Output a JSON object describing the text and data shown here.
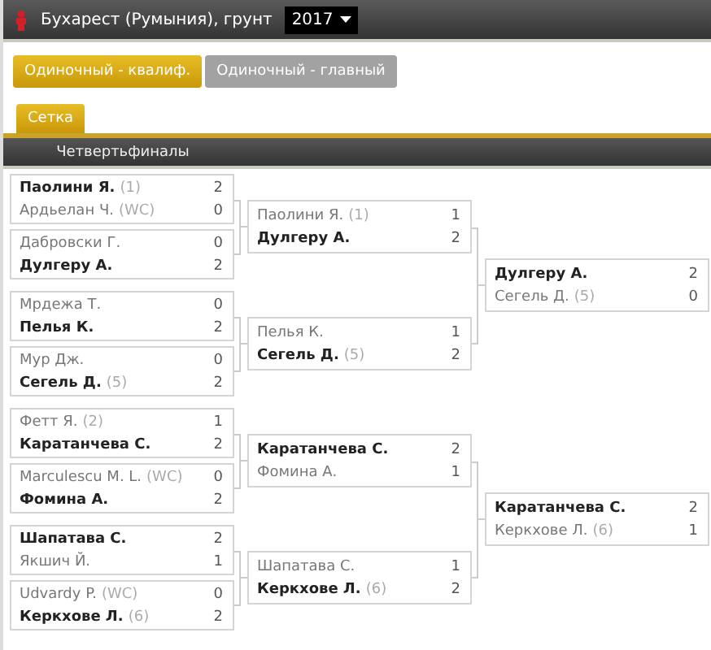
{
  "header": {
    "tournament": "Бухарест (Румыния), грунт",
    "year": "2017"
  },
  "draw_tabs": [
    {
      "label": "Одиночный - квалиф.",
      "selected": true
    },
    {
      "label": "Одиночный - главный",
      "selected": false
    }
  ],
  "view_tabs": [
    {
      "label": "Сетка",
      "selected": true
    }
  ],
  "rounds": [
    {
      "title": "Четвертьфиналы",
      "matches": [
        {
          "players": [
            {
              "name": "Паолини Я.",
              "seed": "(1)",
              "score": "2",
              "winner": true
            },
            {
              "name": "Ардьелан Ч.",
              "seed": "(WC)",
              "score": "0",
              "winner": false
            }
          ]
        },
        {
          "players": [
            {
              "name": "Дабровски Г.",
              "score": "0",
              "winner": false
            },
            {
              "name": "Дулгеру А.",
              "score": "2",
              "winner": true
            }
          ]
        },
        {
          "players": [
            {
              "name": "Мрдежа Т.",
              "score": "0",
              "winner": false
            },
            {
              "name": "Пелья К.",
              "score": "2",
              "winner": true
            }
          ]
        },
        {
          "players": [
            {
              "name": "Мур Дж.",
              "score": "0",
              "winner": false
            },
            {
              "name": "Сегель Д.",
              "seed": "(5)",
              "score": "2",
              "winner": true
            }
          ]
        },
        {
          "players": [
            {
              "name": "Фетт Я.",
              "seed": "(2)",
              "score": "1",
              "winner": false
            },
            {
              "name": "Каратанчева С.",
              "score": "2",
              "winner": true
            }
          ]
        },
        {
          "players": [
            {
              "name": "Marculescu M. L.",
              "seed": "(WC)",
              "score": "0",
              "winner": false
            },
            {
              "name": "Фомина А.",
              "score": "2",
              "winner": true
            }
          ]
        },
        {
          "players": [
            {
              "name": "Шапатава С.",
              "score": "2",
              "winner": true
            },
            {
              "name": "Якшич Й.",
              "score": "1",
              "winner": false
            }
          ]
        },
        {
          "players": [
            {
              "name": "Udvardy P.",
              "seed": "(WC)",
              "score": "0",
              "winner": false
            },
            {
              "name": "Керкхове Л.",
              "seed": "(6)",
              "score": "2",
              "winner": true
            }
          ]
        }
      ]
    },
    {
      "matches": [
        {
          "players": [
            {
              "name": "Паолини Я.",
              "seed": "(1)",
              "score": "1",
              "winner": false
            },
            {
              "name": "Дулгеру А.",
              "score": "2",
              "winner": true
            }
          ]
        },
        {
          "players": [
            {
              "name": "Пелья К.",
              "score": "1",
              "winner": false
            },
            {
              "name": "Сегель Д.",
              "seed": "(5)",
              "score": "2",
              "winner": true
            }
          ]
        },
        {
          "players": [
            {
              "name": "Каратанчева С.",
              "score": "2",
              "winner": true
            },
            {
              "name": "Фомина А.",
              "score": "1",
              "winner": false
            }
          ]
        },
        {
          "players": [
            {
              "name": "Шапатава С.",
              "score": "1",
              "winner": false
            },
            {
              "name": "Керкхове Л.",
              "seed": "(6)",
              "score": "2",
              "winner": true
            }
          ]
        }
      ]
    },
    {
      "matches": [
        {
          "players": [
            {
              "name": "Дулгеру А.",
              "score": "2",
              "winner": true
            },
            {
              "name": "Сегель Д.",
              "seed": "(5)",
              "score": "0",
              "winner": false
            }
          ]
        },
        {
          "players": [
            {
              "name": "Каратанчева С.",
              "score": "2",
              "winner": true
            },
            {
              "name": "Керкхове Л.",
              "seed": "(6)",
              "score": "1",
              "winner": false
            }
          ]
        }
      ]
    }
  ]
}
